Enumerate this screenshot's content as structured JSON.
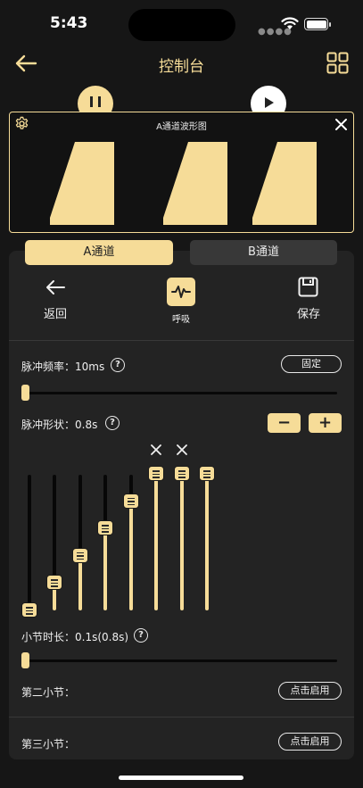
{
  "status": {
    "time": "5:43"
  },
  "nav": {
    "title": "控制台"
  },
  "waveform": {
    "title": "A通道波形图"
  },
  "tabs": [
    {
      "label": "A通道"
    },
    {
      "label": "B通道"
    }
  ],
  "tools": {
    "back": "返回",
    "breath": "呼吸",
    "save": "保存"
  },
  "pulse_freq": {
    "label": "脉冲频率：",
    "value": "10ms",
    "button": "固定",
    "slider_fraction": 0.0
  },
  "pulse_shape": {
    "label": "脉冲形状：",
    "value": "0.8s",
    "minus": "−",
    "plus": "+"
  },
  "shape_sliders": [
    0.0,
    0.2,
    0.4,
    0.6,
    0.8,
    1.0,
    1.0,
    1.0
  ],
  "shape_slider_removable": [
    false,
    false,
    false,
    false,
    false,
    true,
    true,
    false
  ],
  "section_duration": {
    "label": "小节时长：",
    "value": "0.1s(0.8s)",
    "slider_fraction": 0.0
  },
  "section2": {
    "label": "第二小节：",
    "button": "点击启用"
  },
  "section3": {
    "label": "第三小节：",
    "button": "点击启用"
  },
  "colors": {
    "accent": "#f6dc98",
    "background": "#161616",
    "panel": "#232323"
  }
}
